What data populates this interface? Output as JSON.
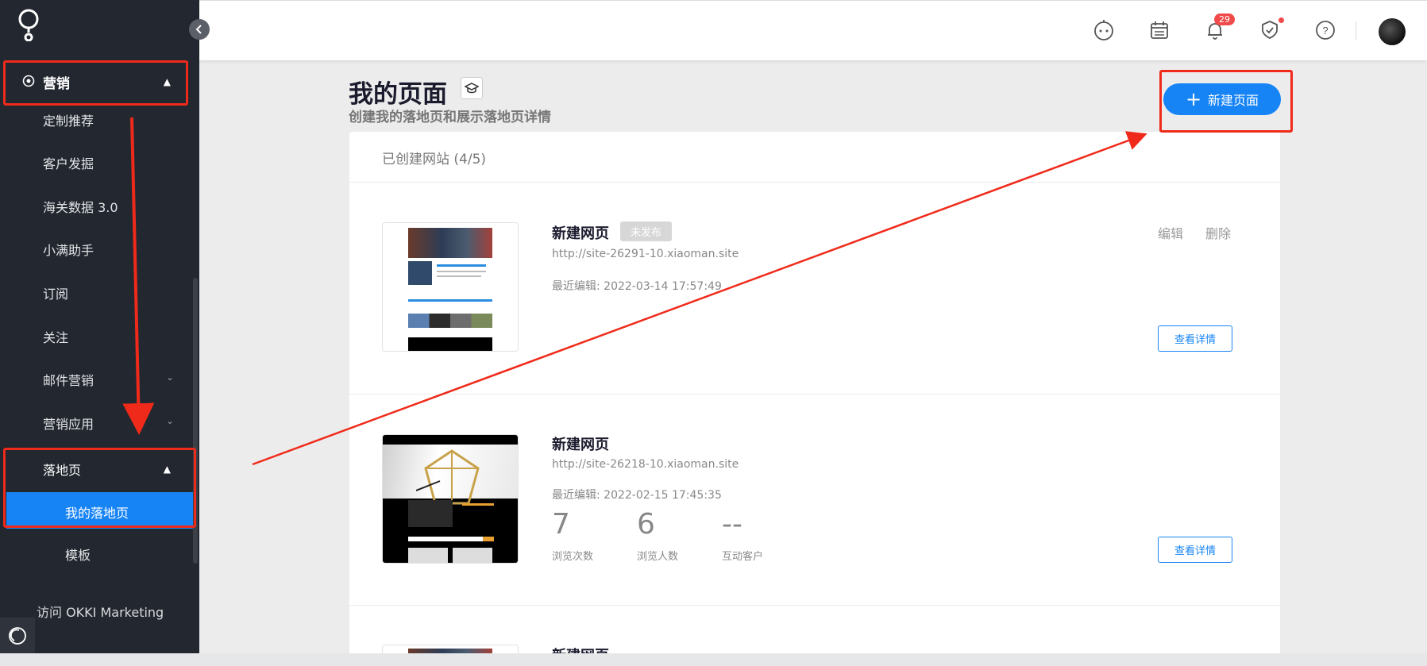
{
  "sidebar": {
    "section_marketing": "营销",
    "items": [
      "定制推荐",
      "客户发掘",
      "海关数据 3.0",
      "小满助手",
      "订阅",
      "关注",
      "邮件营销",
      "营销应用"
    ],
    "section_landing": "落地页",
    "sub_items": [
      "我的落地页",
      "模板"
    ],
    "footer_link": "访问 OKKI Marketing"
  },
  "topbar": {
    "notification_count": "29",
    "icons": [
      "robot-icon",
      "calendar-icon",
      "bell-icon",
      "shield-icon",
      "help-icon"
    ]
  },
  "page": {
    "title": "我的页面",
    "subtitle": "创建我的落地页和展示落地页详情",
    "new_button": "新建页面",
    "list_header": "已创建网站 (4/5)"
  },
  "sites": [
    {
      "name": "新建网页",
      "status": "未发布",
      "url": "http://site-26291-10.xiaoman.site",
      "edited": "最近编辑: 2022-03-14 17:57:49",
      "edit_label": "编辑",
      "delete_label": "删除",
      "detail_label": "查看详情"
    },
    {
      "name": "新建网页",
      "url": "http://site-26218-10.xiaoman.site",
      "edited": "最近编辑: 2022-02-15 17:45:35",
      "stats": [
        {
          "value": "7",
          "label": "浏览次数"
        },
        {
          "value": "6",
          "label": "浏览人数"
        },
        {
          "value": "--",
          "label": "互动客户"
        }
      ],
      "detail_label": "查看详情"
    },
    {
      "name": "新建网页"
    }
  ],
  "colors": {
    "accent": "#1784f6",
    "sidebar_bg": "#222730",
    "annotation_red": "#f02a1a"
  }
}
